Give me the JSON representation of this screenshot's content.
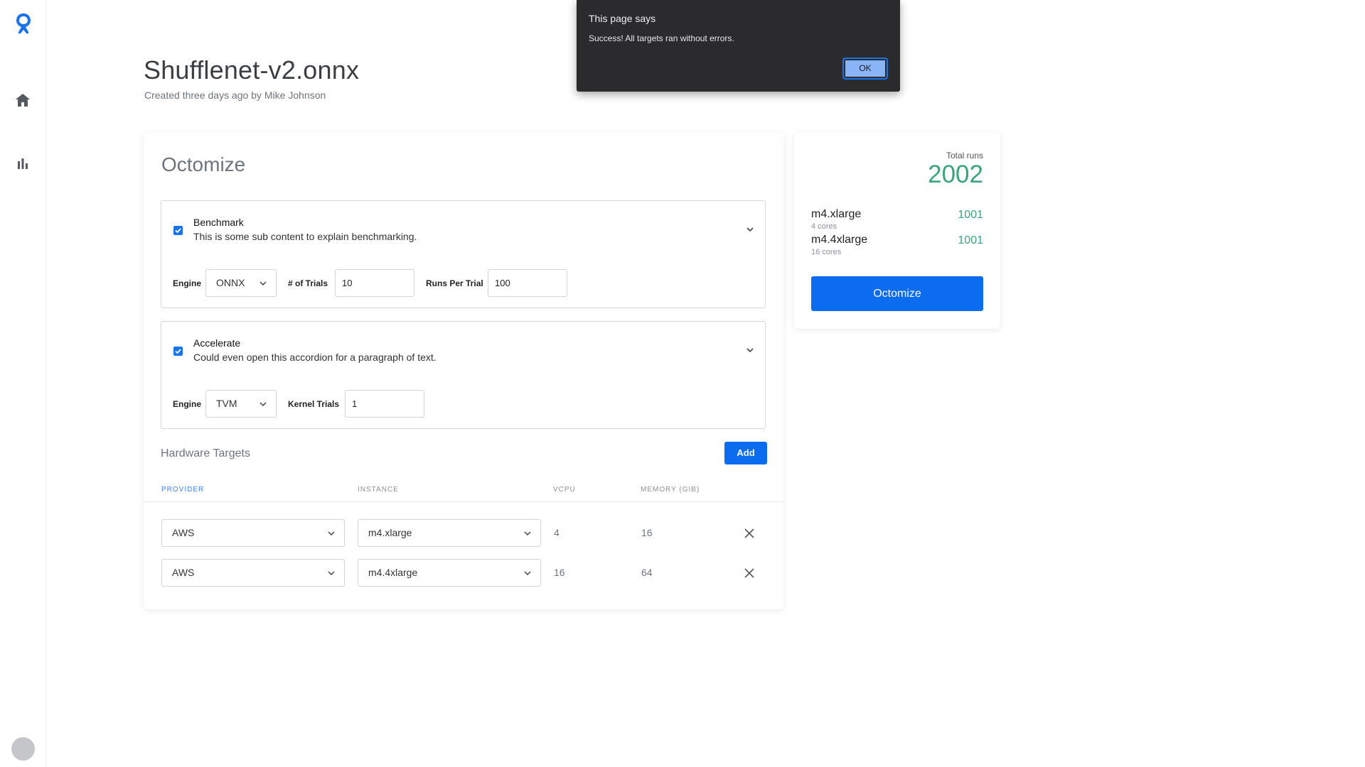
{
  "page": {
    "title": "Shufflenet-v2.onnx",
    "subtitle": "Created three days ago by Mike Johnson"
  },
  "sidebar": {
    "logo_icon": "octoml-logo-icon",
    "items": [
      {
        "name": "home",
        "icon": "home-icon"
      },
      {
        "name": "analytics",
        "icon": "bar-chart-icon"
      }
    ],
    "avatar": "user-avatar"
  },
  "octomize": {
    "title": "Octomize",
    "benchmark": {
      "checked": true,
      "title": "Benchmark",
      "desc": "This is some sub content to explain benchmarking.",
      "engine_label": "Engine",
      "engine_value": "ONNX",
      "trials_label": "# of Trials",
      "trials_value": "10",
      "runs_label": "Runs Per Trial",
      "runs_value": "100"
    },
    "accelerate": {
      "checked": true,
      "title": "Accelerate",
      "desc": "Could even open this accordion for a paragraph of text.",
      "engine_label": "Engine",
      "engine_value": "TVM",
      "kernel_label": "Kernel Trials",
      "kernel_value": "1"
    },
    "hardware": {
      "title": "Hardware Targets",
      "add_label": "Add",
      "columns": [
        "PROVIDER",
        "INSTANCE",
        "VCPU",
        "MEMORY (GIB)"
      ],
      "rows": [
        {
          "provider": "AWS",
          "instance": "m4.xlarge",
          "vcpu": "4",
          "memory": "16"
        },
        {
          "provider": "AWS",
          "instance": "m4.4xlarge",
          "vcpu": "16",
          "memory": "64"
        }
      ]
    }
  },
  "summary": {
    "total_label": "Total runs",
    "total_value": "2002",
    "instances": [
      {
        "name": "m4.xlarge",
        "cores": "4 cores",
        "runs": "1001"
      },
      {
        "name": "m4.4xlarge",
        "cores": "16 cores",
        "runs": "1001"
      }
    ],
    "button_label": "Octomize"
  },
  "dialog": {
    "title": "This page says",
    "message": "Success! All targets ran without errors.",
    "ok_label": "OK"
  },
  "colors": {
    "accent": "#0b6cf0",
    "success": "#3aa57a",
    "dialog_bg": "#2b2b2e"
  }
}
